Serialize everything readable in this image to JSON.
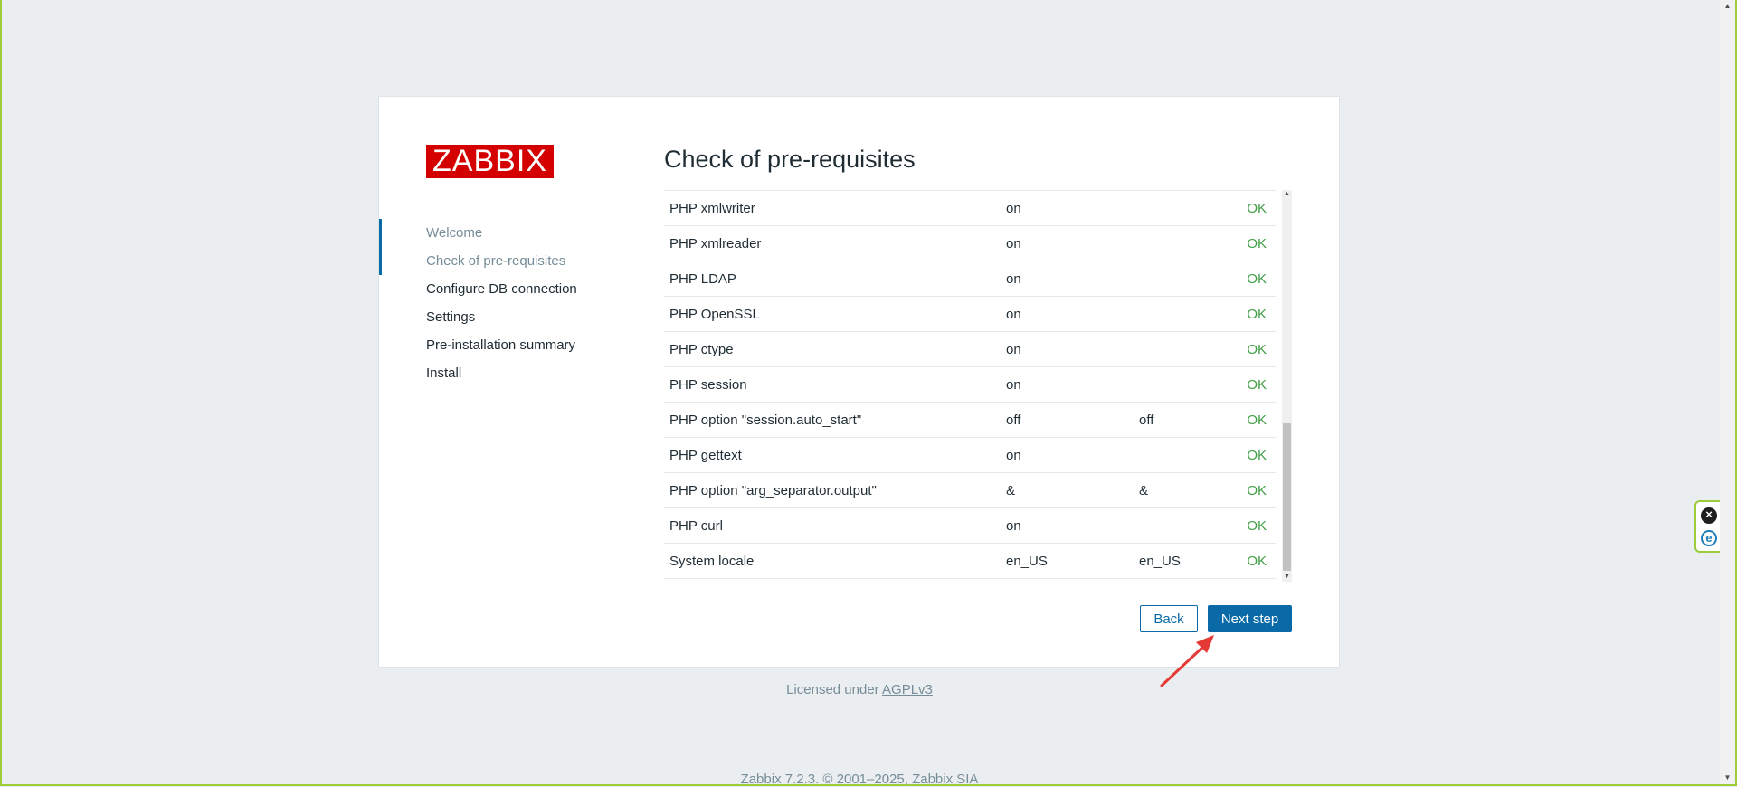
{
  "logo": {
    "text": "ZABBIX"
  },
  "nav": {
    "items": [
      {
        "label": "Welcome",
        "state": "done"
      },
      {
        "label": "Check of pre-requisites",
        "state": "current"
      },
      {
        "label": "Configure DB connection",
        "state": "pending"
      },
      {
        "label": "Settings",
        "state": "pending"
      },
      {
        "label": "Pre-installation summary",
        "state": "pending"
      },
      {
        "label": "Install",
        "state": "pending"
      }
    ]
  },
  "main": {
    "title": "Check of pre-requisites",
    "rows": [
      {
        "name": "PHP xmlwriter",
        "current": "on",
        "required": "",
        "result": "OK"
      },
      {
        "name": "PHP xmlreader",
        "current": "on",
        "required": "",
        "result": "OK"
      },
      {
        "name": "PHP LDAP",
        "current": "on",
        "required": "",
        "result": "OK"
      },
      {
        "name": "PHP OpenSSL",
        "current": "on",
        "required": "",
        "result": "OK"
      },
      {
        "name": "PHP ctype",
        "current": "on",
        "required": "",
        "result": "OK"
      },
      {
        "name": "PHP session",
        "current": "on",
        "required": "",
        "result": "OK"
      },
      {
        "name": "PHP option \"session.auto_start\"",
        "current": "off",
        "required": "off",
        "result": "OK"
      },
      {
        "name": "PHP gettext",
        "current": "on",
        "required": "",
        "result": "OK"
      },
      {
        "name": "PHP option \"arg_separator.output\"",
        "current": "&",
        "required": "&",
        "result": "OK"
      },
      {
        "name": "PHP curl",
        "current": "on",
        "required": "",
        "result": "OK"
      },
      {
        "name": "System locale",
        "current": "en_US",
        "required": "en_US",
        "result": "OK"
      }
    ]
  },
  "buttons": {
    "back": "Back",
    "next": "Next step"
  },
  "footer": {
    "license_prefix": "Licensed under",
    "license_link": "AGPLv3",
    "copyright": "Zabbix 7.2.3. © 2001–2025, Zabbix SIA"
  },
  "colors": {
    "brand_red": "#d40000",
    "primary_blue": "#0a6aa8",
    "ok_green": "#429e47",
    "background": "#ebeef0",
    "annotation_arrow": "#e53935"
  }
}
